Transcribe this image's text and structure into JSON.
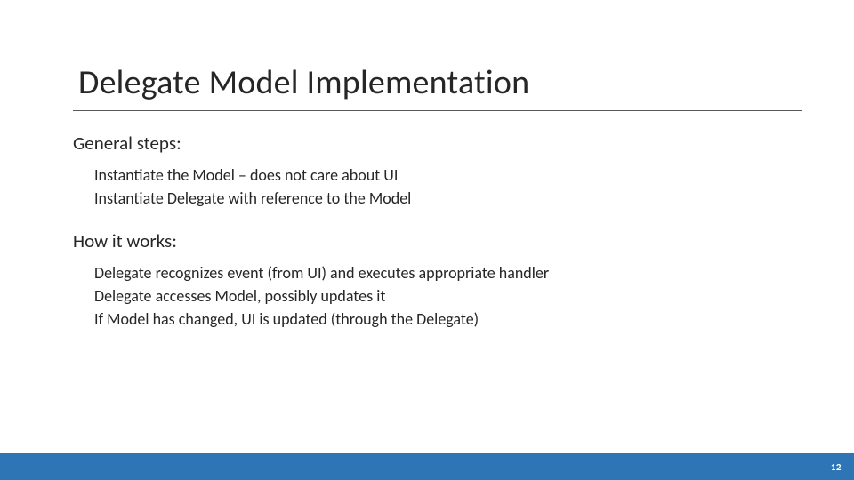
{
  "title": "Delegate Model Implementation",
  "sections": [
    {
      "heading": "General steps:",
      "items": [
        "Instantiate the Model – does not care about UI",
        "Instantiate Delegate with reference to the Model"
      ]
    },
    {
      "heading": "How it works:",
      "items": [
        "Delegate recognizes event (from UI) and executes appropriate handler",
        "Delegate accesses Model, possibly updates it",
        "If Model has changed, UI is updated (through the Delegate)"
      ]
    }
  ],
  "page_number": "12"
}
